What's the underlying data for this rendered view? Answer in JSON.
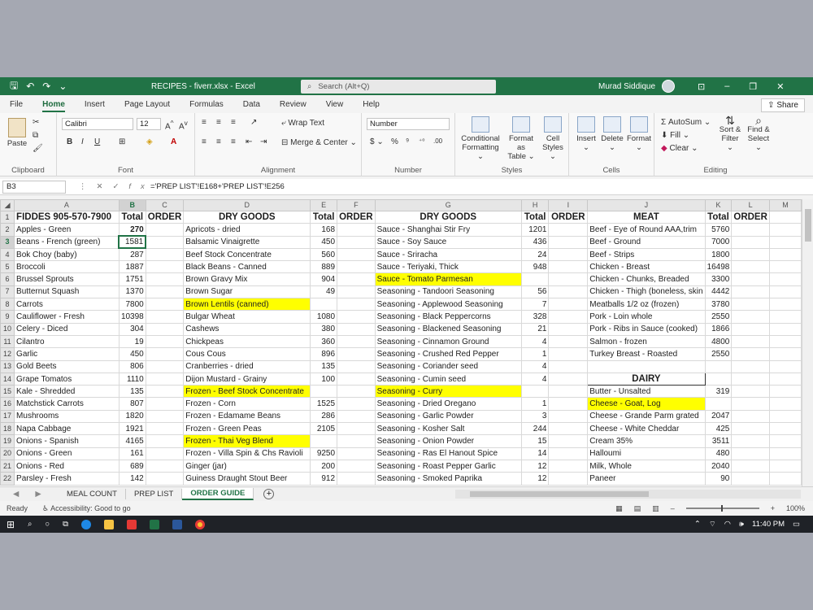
{
  "titlebar": {
    "filename": "RECIPES - fiverr.xlsx  -  Excel",
    "search_placeholder": "Search (Alt+Q)",
    "user": "Murad Siddique"
  },
  "tabs": [
    "File",
    "Home",
    "Insert",
    "Page Layout",
    "Formulas",
    "Data",
    "Review",
    "View",
    "Help"
  ],
  "share_label": "Share",
  "ribbon": {
    "paste": "Paste",
    "clipboard": "Clipboard",
    "font_name": "Calibri",
    "font_size": "12",
    "font": "Font",
    "wrap_text": "Wrap Text",
    "merge_center": "Merge & Center",
    "alignment": "Alignment",
    "number_format": "Number",
    "number": "Number",
    "conditional": "Conditional",
    "formatting": "Formatting",
    "format_as": "Format as",
    "table": "Table",
    "cell": "Cell",
    "styles_btn": "Styles",
    "styles": "Styles",
    "insert": "Insert",
    "delete": "Delete",
    "format": "Format",
    "cells": "Cells",
    "autosum": "AutoSum",
    "fill": "Fill",
    "clear": "Clear",
    "sort": "Sort &",
    "filter": "Filter",
    "find": "Find &",
    "select": "Select",
    "editing": "Editing"
  },
  "formula_bar": {
    "name_box": "B3",
    "formula": "='PREP LIST'!E168+'PREP LIST'!E256"
  },
  "columns": [
    "A",
    "B",
    "C",
    "D",
    "E",
    "F",
    "G",
    "H",
    "I",
    "J",
    "K",
    "L",
    "M"
  ],
  "header_row": [
    "FIDDES 905-570-7900",
    "Total",
    "ORDER",
    "DRY GOODS",
    "Total",
    "ORDER",
    "DRY GOODS",
    "Total",
    "ORDER",
    "MEAT",
    "Total",
    "ORDER",
    ""
  ],
  "rows": [
    [
      "Apples - Green",
      "270",
      "",
      "Apricots - dried",
      "168",
      "",
      "Sauce - Shanghai Stir Fry",
      "1201",
      "",
      "Beef - Eye of Round AAA,trim",
      "5760",
      "",
      ""
    ],
    [
      "Beans - French (green)",
      "1581",
      "",
      "Balsamic Vinaigrette",
      "450",
      "",
      "Sauce - Soy Sauce",
      "436",
      "",
      "Beef - Ground",
      "7000",
      "",
      ""
    ],
    [
      "Bok Choy (baby)",
      "287",
      "",
      "Beef Stock Concentrate",
      "560",
      "",
      "Sauce - Sriracha",
      "24",
      "",
      "Beef - Strips",
      "1800",
      "",
      ""
    ],
    [
      "Broccoli",
      "1887",
      "",
      "Black Beans - Canned",
      "889",
      "",
      "Sauce - Teriyaki, Thick",
      "948",
      "",
      "Chicken - Breast",
      "16498",
      "",
      ""
    ],
    [
      "Brussel Sprouts",
      "1751",
      "",
      "Brown Gravy Mix",
      "904",
      "",
      "Sauce - Tomato Parmesan",
      "",
      "",
      "Chicken - Chunks, Breaded",
      "3300",
      "",
      ""
    ],
    [
      "Butternut Squash",
      "1370",
      "",
      "Brown Sugar",
      "49",
      "",
      "Seasoning  - Tandoori Seasoning",
      "56",
      "",
      "Chicken - Thigh (boneless, skin",
      "4442",
      "",
      ""
    ],
    [
      "Carrots",
      "7800",
      "",
      "Brown Lentils (canned)",
      "",
      "",
      "Seasoning - Applewood Seasoning",
      "7",
      "",
      "Meatballs 1/2 oz (frozen)",
      "3780",
      "",
      ""
    ],
    [
      "Cauliflower - Fresh",
      "10398",
      "",
      "Bulgar Wheat",
      "1080",
      "",
      "Seasoning - Black Peppercorns",
      "328",
      "",
      "Pork - Loin whole",
      "2550",
      "",
      ""
    ],
    [
      "Celery - Diced",
      "304",
      "",
      "Cashews",
      "380",
      "",
      "Seasoning - Blackened Seasoning",
      "21",
      "",
      "Pork - Ribs in Sauce (cooked)",
      "1866",
      "",
      ""
    ],
    [
      "Cilantro",
      "19",
      "",
      "Chickpeas",
      "360",
      "",
      "Seasoning - Cinnamon Ground",
      "4",
      "",
      "Salmon - frozen",
      "4800",
      "",
      ""
    ],
    [
      "Garlic",
      "450",
      "",
      "Cous Cous",
      "896",
      "",
      "Seasoning - Crushed Red Pepper",
      "1",
      "",
      "Turkey Breast - Roasted",
      "2550",
      "",
      ""
    ],
    [
      "Gold Beets",
      "806",
      "",
      "Cranberries - dried",
      "135",
      "",
      "Seasoning - Coriander seed",
      "4",
      "",
      "",
      "",
      "",
      ""
    ],
    [
      "Grape Tomatos",
      "1110",
      "",
      "Dijon Mustard - Grainy",
      "100",
      "",
      "Seasoning - Cumin seed",
      "4",
      "",
      "DAIRY",
      "",
      "",
      ""
    ],
    [
      "Kale - Shredded",
      "135",
      "",
      "Frozen - Beef Stock Concentrate",
      "",
      "",
      "Seasoning - Curry",
      "",
      "",
      "Butter - Unsalted",
      "319",
      "",
      ""
    ],
    [
      "Matchstick Carrots",
      "807",
      "",
      "Frozen - Corn",
      "1525",
      "",
      "Seasoning - Dried Oregano",
      "1",
      "",
      "Cheese - Goat, Log",
      "",
      "",
      ""
    ],
    [
      "Mushrooms",
      "1820",
      "",
      "Frozen - Edamame Beans",
      "286",
      "",
      "Seasoning - Garlic Powder",
      "3",
      "",
      "Cheese - Grande Parm grated",
      "2047",
      "",
      ""
    ],
    [
      "Napa Cabbage",
      "1921",
      "",
      "Frozen - Green Peas",
      "2105",
      "",
      "Seasoning - Kosher Salt",
      "244",
      "",
      "Cheese - White Cheddar",
      "425",
      "",
      ""
    ],
    [
      "Onions - Spanish",
      "4165",
      "",
      "Frozen - Thai Veg Blend",
      "",
      "",
      "Seasoning - Onion Powder",
      "15",
      "",
      "Cream 35%",
      "3511",
      "",
      ""
    ],
    [
      "Onions - Green",
      "161",
      "",
      "Frozen - Villa Spin & Chs Ravioli",
      "9250",
      "",
      "Seasoning - Ras El Hanout Spice",
      "14",
      "",
      "Halloumi",
      "480",
      "",
      ""
    ],
    [
      "Onions - Red",
      "689",
      "",
      "Ginger (jar)",
      "200",
      "",
      "Seasoning - Roast Pepper Garlic",
      "12",
      "",
      "Milk, Whole",
      "2040",
      "",
      ""
    ],
    [
      "Parsley - Fresh",
      "142",
      "",
      "Guiness Draught Stout Beer",
      "912",
      "",
      "Seasoning - Smoked Paprika",
      "12",
      "",
      "Paneer",
      "90",
      "",
      ""
    ]
  ],
  "sheet_tabs": [
    "MEAL COUNT",
    "PREP LIST",
    "ORDER GUIDE"
  ],
  "status": {
    "ready": "Ready",
    "accessibility": "Accessibility: Good to go",
    "zoom": "100%"
  },
  "taskbar": {
    "time": "11:40 PM"
  },
  "colors": {
    "excel_green": "#217346",
    "highlight": "#ffff00"
  }
}
